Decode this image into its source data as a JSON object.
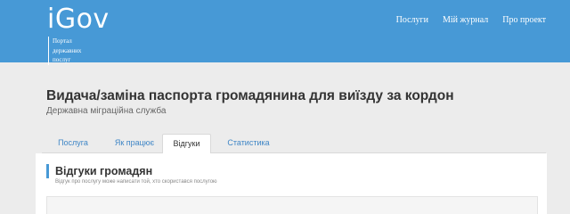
{
  "header": {
    "logo": "iGov",
    "tagline": [
      "Портал",
      "державних",
      "послуг"
    ],
    "nav": [
      {
        "label": "Послуги"
      },
      {
        "label": "Мій журнал"
      },
      {
        "label": "Про проект"
      }
    ]
  },
  "page": {
    "title": "Видача/заміна паспорта громадянина для виїзду за кордон",
    "subtitle": "Державна міграційна служба"
  },
  "tabs": [
    {
      "label": "Послуга",
      "active": false
    },
    {
      "label": "Як працює",
      "active": false
    },
    {
      "label": "Відгуки",
      "active": true
    },
    {
      "label": "Статистика",
      "active": false
    }
  ],
  "feedback": {
    "title": "Відгуки громадян",
    "note": "Відгук про послугу може написати той, хто скористався послугою"
  },
  "colors": {
    "header": "#4799d6",
    "link": "#3f86c6",
    "background": "#ececec"
  }
}
